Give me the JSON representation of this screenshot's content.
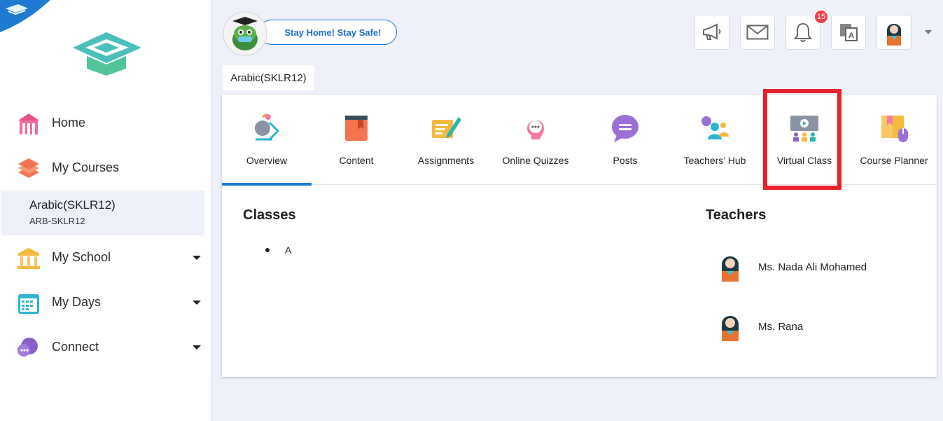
{
  "sidebar": {
    "nav": [
      {
        "label": "Home",
        "icon": "home-icon"
      },
      {
        "label": "My Courses",
        "icon": "books-icon"
      },
      {
        "label": "My School",
        "icon": "school-icon"
      },
      {
        "label": "My Days",
        "icon": "calendar-icon"
      },
      {
        "label": "Connect",
        "icon": "chat-icon"
      }
    ],
    "active_course": {
      "name": "Arabic(SKLR12)",
      "code": "ARB-SKLR12"
    }
  },
  "header": {
    "banner": "Stay Home! Stay Safe!",
    "notification_count": "15",
    "buttons": [
      "megaphone-icon",
      "mail-icon",
      "bell-icon",
      "translate-icon",
      "avatar"
    ]
  },
  "course_tab": "Arabic(SKLR12)",
  "tabs": [
    {
      "label": "Overview",
      "icon": "overview-icon"
    },
    {
      "label": "Content",
      "icon": "book-icon"
    },
    {
      "label": "Assignments",
      "icon": "assignment-icon"
    },
    {
      "label": "Online Quizzes",
      "icon": "quiz-icon"
    },
    {
      "label": "Posts",
      "icon": "posts-icon"
    },
    {
      "label": "Teachers’ Hub",
      "icon": "teachers-hub-icon"
    },
    {
      "label": "Virtual Class",
      "icon": "virtual-class-icon"
    },
    {
      "label": "Course Planner",
      "icon": "course-planner-icon"
    }
  ],
  "active_tab": "Overview",
  "highlighted_tab": "Virtual Class",
  "classes": {
    "title": "Classes",
    "items": [
      "A"
    ]
  },
  "teachers": {
    "title": "Teachers",
    "items": [
      "Ms. Nada Ali Mohamed",
      "Ms. Rana"
    ]
  },
  "colors": {
    "accent": "#1a7fd4",
    "highlight": "#e8202a",
    "badge": "#ef3d4a",
    "background": "#eef0fa"
  }
}
